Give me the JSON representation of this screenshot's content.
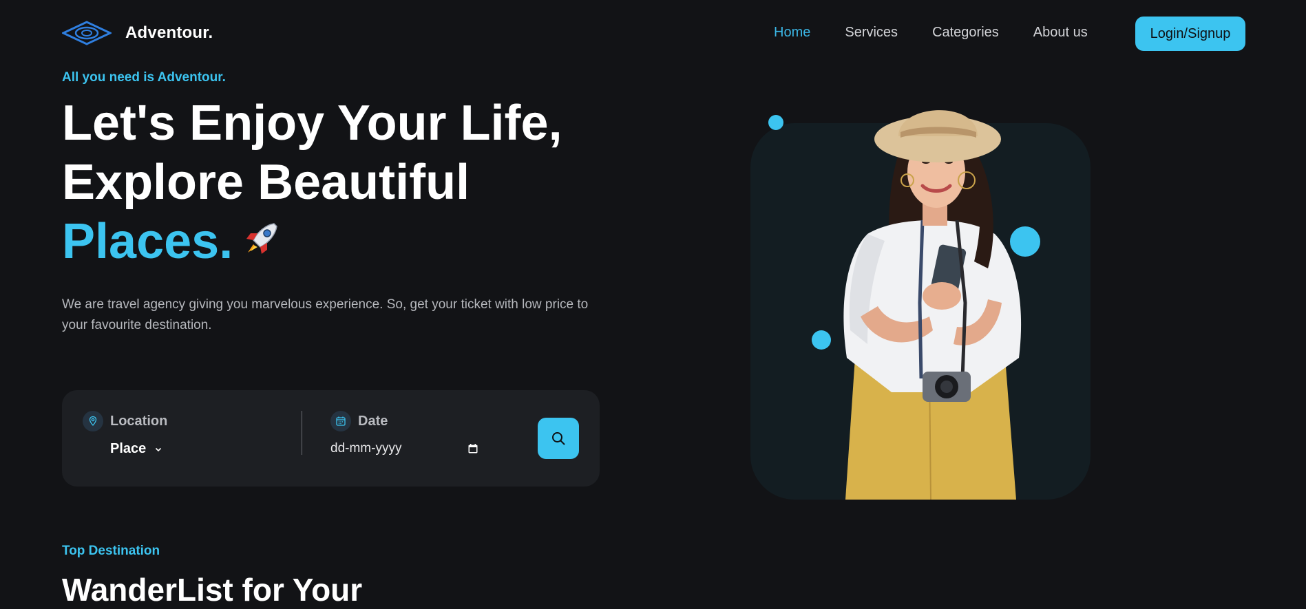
{
  "header": {
    "brand": "Adventour.",
    "nav": [
      {
        "label": "Home",
        "active": true
      },
      {
        "label": "Services",
        "active": false
      },
      {
        "label": "Categories",
        "active": false
      },
      {
        "label": "About us",
        "active": false
      }
    ],
    "login_label": "Login/Signup"
  },
  "hero": {
    "tagline": "All you need is Adventour.",
    "title_line1": "Let's Enjoy Your Life,",
    "title_line2": "Explore Beautiful",
    "title_line3": "Places.",
    "description": "We are travel agency giving you marvelous experience. So, get your ticket with low price to your favourite destination."
  },
  "search": {
    "location_label": "Location",
    "location_value": "Place",
    "date_label": "Date",
    "date_placeholder": "dd-mm-yyyy"
  },
  "section": {
    "kicker": "Top Destination",
    "title": "WanderList for Your"
  },
  "colors": {
    "background": "#121316",
    "accent": "#3cc4f0",
    "panel": "#1d1f23",
    "card": "#131d22"
  },
  "icons": {
    "logo": "eye-logo-icon",
    "location": "map-pin-icon",
    "date": "calendar-icon",
    "search": "search-icon",
    "rocket": "rocket-icon"
  }
}
